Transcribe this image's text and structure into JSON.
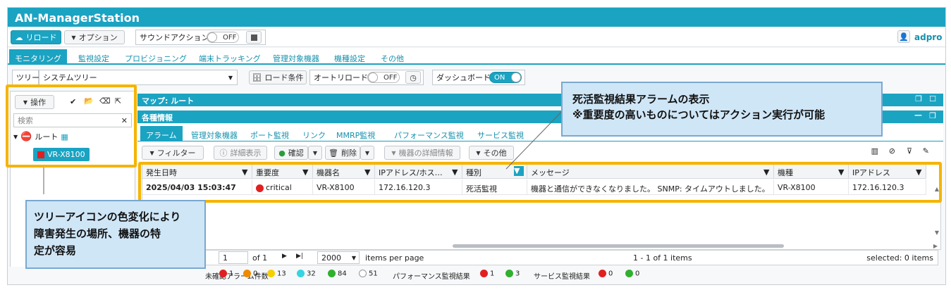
{
  "app": {
    "title": "AN-ManagerStation",
    "user": "adpro"
  },
  "toolbar": {
    "reload": "リロード",
    "options": "オプション",
    "sound_action": "サウンドアクション",
    "sound_state": "OFF"
  },
  "nav_tabs": [
    "モニタリング",
    "監視設定",
    "プロビジョニング",
    "端末トラッキング",
    "管理対象機器",
    "機種設定",
    "その他"
  ],
  "filter": {
    "tree_label": "ツリー",
    "tree_value": "システムツリー",
    "load_cond": "ロード条件",
    "auto_reload": "オートリロード",
    "auto_reload_state": "OFF",
    "dashboard": "ダッシュボード",
    "dashboard_state": "ON"
  },
  "sidebar": {
    "operations": "操作",
    "search_placeholder": "検索",
    "root": "ルート",
    "device": "VR-X8100"
  },
  "map_panel": {
    "title": "マップ: ルート"
  },
  "info_panel": {
    "title": "各種情報",
    "tabs": [
      "アラーム",
      "管理対象機器",
      "ポート監視",
      "リンク",
      "MMRP監視",
      "パフォーマンス監視",
      "サービス監視"
    ],
    "actions": {
      "filter": "フィルター",
      "detail": "詳細表示",
      "confirm": "確認",
      "delete": "削除",
      "device_detail": "機器の詳細情報",
      "other": "その他"
    },
    "columns": [
      "発生日時",
      "重要度",
      "機器名",
      "IPアドレス/ホス…",
      "種別",
      "メッセージ",
      "機種",
      "IPアドレス"
    ],
    "rows": [
      {
        "time": "2025/04/03 15:03:47",
        "severity": "critical",
        "device": "VR-X8100",
        "ip_host": "172.16.120.3",
        "type": "死活監視",
        "message": "機器と通信ができなくなりました。 SNMP: タイムアウトしました。",
        "model": "VR-X8100",
        "ip": "172.16.120.3"
      }
    ],
    "pager": {
      "page": "1",
      "of": "of 1",
      "per_page": "2000",
      "per_page_label": "items per page",
      "range": "1 - 1 of 1 items",
      "selected": "selected: 0 items"
    }
  },
  "status": {
    "alarm_label": "未確認アラーム件数",
    "alarm_counts": [
      "1",
      "0",
      "13",
      "32",
      "84",
      "51"
    ],
    "perf_label": "パフォーマンス監視結果",
    "perf_counts": [
      "1",
      "3"
    ],
    "svc_label": "サービス監視結果",
    "svc_counts": [
      "0",
      "0"
    ]
  },
  "callouts": {
    "alarm_line1": "死活監視結果アラームの表示",
    "alarm_line2": "※重要度の高いものについてはアクション実行が可能",
    "tree_line1": "ツリーアイコンの色変化により",
    "tree_line2": "障害発生の場所、機器の特",
    "tree_line3": "定が容易"
  },
  "colors": {
    "accent": "#1ba3c2",
    "critical": "#e02020",
    "highlight": "#f5b400"
  }
}
